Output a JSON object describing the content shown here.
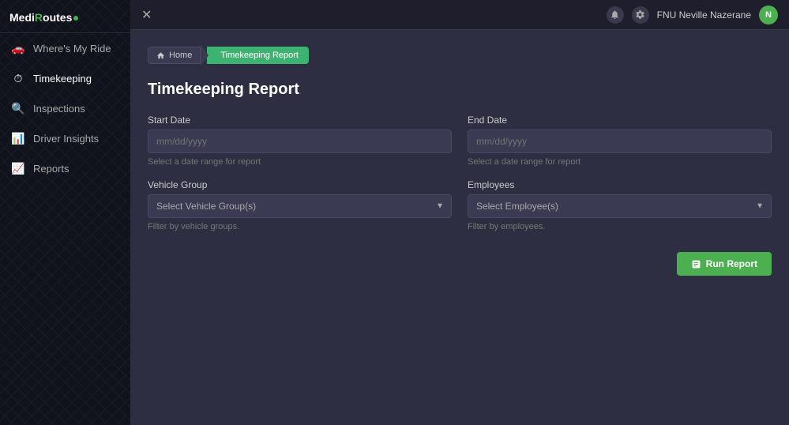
{
  "app": {
    "name": "MediR",
    "name_highlight": "o",
    "name_suffix": "utes",
    "logo_text": "MediRoutes"
  },
  "sidebar": {
    "items": [
      {
        "id": "wheres-my-ride",
        "label": "Where's My Ride",
        "icon": "🚗",
        "active": false
      },
      {
        "id": "timekeeping",
        "label": "Timekeeping",
        "icon": "⏱",
        "active": true
      },
      {
        "id": "inspections",
        "label": "Inspections",
        "icon": "🔍",
        "active": false
      },
      {
        "id": "driver-insights",
        "label": "Driver Insights",
        "icon": "📊",
        "active": false
      },
      {
        "id": "reports",
        "label": "Reports",
        "icon": "📈",
        "active": false
      }
    ]
  },
  "topbar": {
    "close_label": "✕",
    "icon1": "🔔",
    "icon2": "⚙",
    "username": "FNU Neville Nazerane",
    "avatar_initials": "N"
  },
  "breadcrumb": {
    "home_label": "Home",
    "current_label": "Timekeeping Report"
  },
  "page": {
    "title": "Timekeeping Report"
  },
  "form": {
    "start_date": {
      "label": "Start Date",
      "placeholder": "mm/dd/yyyy",
      "hint": "Select a date range for report"
    },
    "end_date": {
      "label": "End Date",
      "placeholder": "mm/dd/yyyy",
      "hint": "Select a date range for report"
    },
    "vehicle_group": {
      "label": "Vehicle Group",
      "placeholder": "Select Vehicle Group(s)",
      "hint": "Filter by vehicle groups.",
      "options": [
        "Select Vehicle Group(s)"
      ]
    },
    "employees": {
      "label": "Employees",
      "placeholder": "Select Employee(s)",
      "hint": "Filter by employees.",
      "options": [
        "Select Employee(s)"
      ]
    },
    "run_button_label": "Run Report"
  }
}
